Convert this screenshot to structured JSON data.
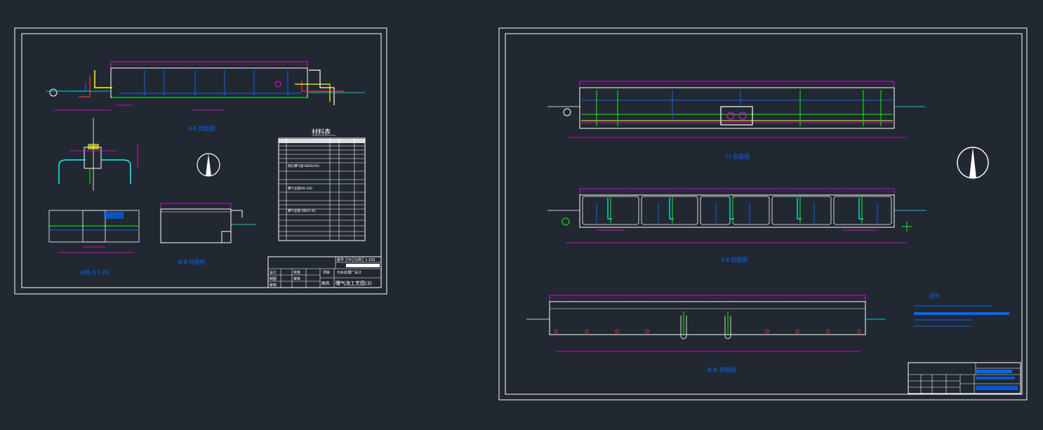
{
  "left_sheet": {
    "material_table_title": "材料表",
    "title_block": {
      "row1": [
        "图号",
        "05",
        "比例",
        "1:100"
      ],
      "designer": "设计",
      "drafter": "制图",
      "checker": "审核",
      "school": "校核",
      "review": "审核",
      "project_label": "项目",
      "project": "污水处理厂设计",
      "name_label": "图名",
      "name": "曝气池工艺图(3)"
    },
    "section_labels": [
      "Ⅱ-Ⅱ 剖面图",
      "详图 A 1:00",
      "Ⅲ-Ⅲ 剖面图"
    ],
    "material_rows": [
      "微孔曝气器 B800(AS)",
      "曝气主管DN 200",
      "曝气支管 DN25-50"
    ]
  },
  "right_sheet": {
    "section_labels": [
      "Ⅰ-Ⅰ 剖面图",
      "Ⅱ-Ⅱ 剖面图",
      "Ⅲ-Ⅲ 剖面图"
    ],
    "notes_title": "说明"
  },
  "colors": {
    "background": "#222831",
    "frame": "#ffffff",
    "magenta": "#ff00ff",
    "green": "#00ff00",
    "blue": "#0066ff",
    "cyan": "#00ffff",
    "yellow": "#ffff00",
    "red": "#ff3030"
  }
}
